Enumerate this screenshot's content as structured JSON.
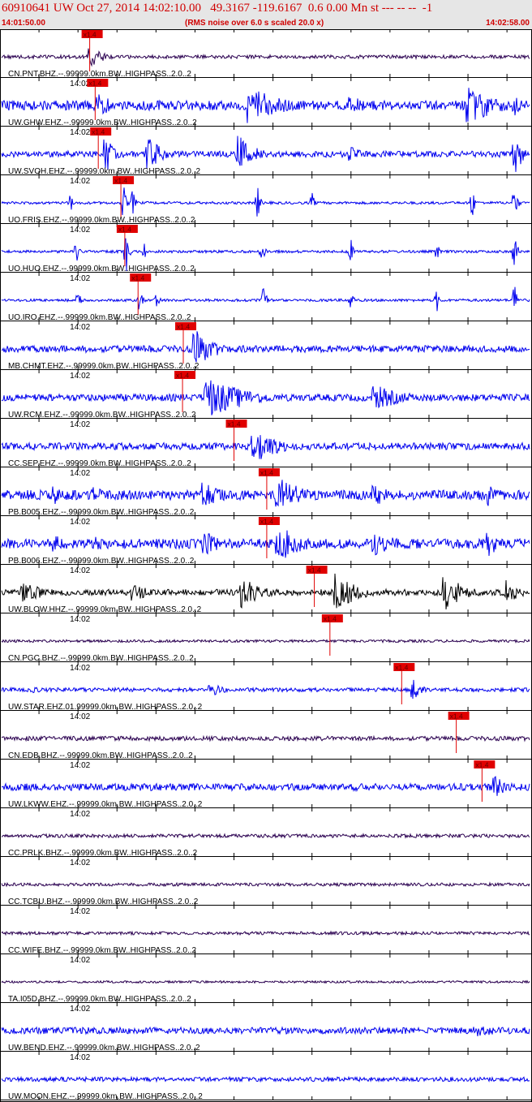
{
  "header": {
    "title": "60910641 UW Oct 27, 2014 14:02:10.00   49.3167 -119.6167  0.6 0.00 Mn st --- -- --  -1",
    "start_time": "14:01:50.00",
    "end_time": "14:02:58.00",
    "subtitle": "(RMS noise over 6.0 s scaled 20.0 x)"
  },
  "chart_data": {
    "type": "line",
    "x_range_seconds": [
      0,
      68
    ],
    "tick_interval_seconds": 5,
    "minute_mark_label": "14:02",
    "minute_mark_second": 10,
    "pick_marker_label": "x1.4",
    "traces": [
      {
        "label": "CN.PNT.BHZ.--.99999.0km.BW..HIGHPASS..2.0..2",
        "color": "#2a0050",
        "pick_second": 11.5,
        "amplitude": 0.08,
        "events": [
          [
            11.6,
            0.55,
            1.5
          ]
        ]
      },
      {
        "label": "UW.GHW.EHZ.--.99999.0km.BW..HIGHPASS..2.0..2",
        "color": "#0000ee",
        "pick_second": 12.2,
        "amplitude": 0.22,
        "events": [
          [
            12.6,
            0.6,
            2
          ],
          [
            32,
            0.9,
            4
          ],
          [
            45,
            0.45,
            3
          ],
          [
            60,
            0.9,
            4
          ],
          [
            66,
            0.5,
            2
          ]
        ]
      },
      {
        "label": "UW.SVOH.EHZ.--.99999.0km.BW..HIGHPASS..2.0..2",
        "color": "#0000ee",
        "pick_second": 12.6,
        "amplitude": 0.14,
        "events": [
          [
            13.6,
            0.9,
            1
          ],
          [
            19,
            0.95,
            1.5
          ],
          [
            30.5,
            0.95,
            2
          ],
          [
            45,
            0.4,
            1.5
          ],
          [
            66,
            1.0,
            1
          ]
        ]
      },
      {
        "label": "UO.FRIS.EHZ.--.99999.0km.BW..HIGHPASS..2.0..2",
        "color": "#0000ee",
        "pick_second": 15.5,
        "amplitude": 0.06,
        "events": [
          [
            9,
            0.55,
            0.3
          ],
          [
            15.8,
            1.0,
            0.3
          ],
          [
            17,
            0.7,
            0.3
          ],
          [
            33,
            0.9,
            0.3
          ],
          [
            40,
            0.5,
            0.3
          ],
          [
            60.5,
            0.95,
            0.3
          ],
          [
            66,
            1.0,
            0.3
          ]
        ]
      },
      {
        "label": "UO.HUO.EHZ.--.99999.0km.BW..HIGHPASS..2.0..2",
        "color": "#0000ee",
        "pick_second": 16.0,
        "amplitude": 0.06,
        "events": [
          [
            9.8,
            0.6,
            0.3
          ],
          [
            16.2,
            1.0,
            0.3
          ],
          [
            18.5,
            0.6,
            0.3
          ],
          [
            33.5,
            0.8,
            0.3
          ],
          [
            45,
            0.6,
            0.3
          ],
          [
            56,
            0.5,
            0.3
          ],
          [
            66,
            1.0,
            0.3
          ]
        ]
      },
      {
        "label": "UO.IRO.EHZ.--.99999.0km.BW..HIGHPASS..2.0..2",
        "color": "#0000ee",
        "pick_second": 17.7,
        "amplitude": 0.06,
        "events": [
          [
            10,
            0.65,
            0.3
          ],
          [
            17.8,
            1.0,
            0.3
          ],
          [
            20,
            0.6,
            0.3
          ],
          [
            33.8,
            0.8,
            0.3
          ],
          [
            45,
            0.6,
            0.3
          ],
          [
            56,
            0.6,
            0.3
          ],
          [
            66,
            1.0,
            0.3
          ]
        ]
      },
      {
        "label": "MB.CHMT.EHZ.--.99999.0km.BW..HIGHPASS..2.0..2",
        "color": "#0000ee",
        "pick_second": 23.5,
        "amplitude": 0.16,
        "events": [
          [
            25,
            0.9,
            2.5
          ]
        ]
      },
      {
        "label": "UW.RCM.EHZ.--.99999.0km.BW..HIGHPASS..2.0..2",
        "color": "#0000ee",
        "pick_second": 23.4,
        "amplitude": 0.16,
        "events": [
          [
            26.5,
            1.0,
            5
          ],
          [
            48,
            0.6,
            4
          ]
        ]
      },
      {
        "label": "CC.SEP.EHZ.--.99999.0km.BW..HIGHPASS..2.0..2",
        "color": "#0000ee",
        "pick_second": 30.0,
        "amplitude": 0.16,
        "events": [
          [
            32.5,
            0.85,
            3
          ]
        ]
      },
      {
        "label": "PB.B005.EHZ.--.99999.0km.BW..HIGHPASS..2.0..2",
        "color": "#0000ee",
        "pick_second": 34.2,
        "amplitude": 0.22,
        "events": [
          [
            7,
            0.5,
            2
          ],
          [
            12,
            0.4,
            2
          ],
          [
            26,
            0.6,
            3
          ],
          [
            35.5,
            0.95,
            3
          ],
          [
            48,
            0.5,
            3
          ],
          [
            62.5,
            0.6,
            1.5
          ]
        ]
      },
      {
        "label": "PB.B006.EHZ.--.99999.0km.BW..HIGHPASS..2.0..2",
        "color": "#0000ee",
        "pick_second": 34.2,
        "amplitude": 0.22,
        "events": [
          [
            7,
            0.5,
            2
          ],
          [
            12,
            0.4,
            2
          ],
          [
            26,
            0.6,
            3
          ],
          [
            35.5,
            0.95,
            3
          ],
          [
            48,
            0.6,
            3
          ],
          [
            62.5,
            0.75,
            1.5
          ]
        ]
      },
      {
        "label": "UW.BLOW.HHZ.--.99999.0km.BW..HIGHPASS..2.0..2",
        "color": "#000000",
        "pick_second": 40.3,
        "amplitude": 0.14,
        "events": [
          [
            3,
            0.5,
            3
          ],
          [
            17,
            0.5,
            2
          ],
          [
            31,
            0.8,
            2.5
          ],
          [
            43,
            0.9,
            3
          ],
          [
            57,
            0.9,
            2.5
          ],
          [
            65,
            0.7,
            1.5
          ]
        ]
      },
      {
        "label": "CN.PGC.BHZ.--.99999.0km.BW..HIGHPASS..2.0..2",
        "color": "#2a0050",
        "pick_second": 42.3,
        "amplitude": 0.06,
        "events": []
      },
      {
        "label": "UW.STAR.EHZ.01.99999.0km.BW..HIGHPASS..2.0..2",
        "color": "#0000ee",
        "pick_second": 51.5,
        "amplitude": 0.09,
        "events": [
          [
            4,
            0.2,
            1.5
          ],
          [
            27,
            0.3,
            2
          ],
          [
            53,
            0.5,
            1
          ]
        ]
      },
      {
        "label": "CN.EDB.BHZ.--.99999.0km.BW..HIGHPASS..2.0..2",
        "color": "#2a0050",
        "pick_second": 58.5,
        "amplitude": 0.1,
        "events": []
      },
      {
        "label": "UW.LKWW.EHZ.--.99999.0km.BW..HIGHPASS..2.0..2",
        "color": "#0000ee",
        "pick_second": 61.8,
        "amplitude": 0.16,
        "events": [
          [
            63.5,
            0.5,
            2
          ]
        ]
      },
      {
        "label": "CC.PRLK.BHZ.--.99999.0km.BW..HIGHPASS..2.0..2",
        "color": "#2a0050",
        "pick_second": null,
        "amplitude": 0.08,
        "events": []
      },
      {
        "label": "CC.TCBU.BHZ.--.99999.0km.BW..HIGHPASS..2.0..2",
        "color": "#2a0050",
        "pick_second": null,
        "amplitude": 0.07,
        "events": []
      },
      {
        "label": "CC.WIFE.BHZ.--.99999.0km.BW..HIGHPASS..2.0..2",
        "color": "#2a0050",
        "pick_second": null,
        "amplitude": 0.07,
        "events": []
      },
      {
        "label": "TA.I05D.BHZ.--.99999.0km.BW..HIGHPASS..2.0..2",
        "color": "#2a0050",
        "pick_second": null,
        "amplitude": 0.05,
        "events": []
      },
      {
        "label": "UW.BEND.EHZ.--.99999.0km.BW..HIGHPASS..2.0..2",
        "color": "#0000ee",
        "pick_second": null,
        "amplitude": 0.15,
        "events": [
          [
            61,
            0.3,
            5
          ]
        ]
      },
      {
        "label": "UW.MOON.EHZ.--.99999.0km.BW..HIGHPASS..2.0..2",
        "color": "#0000ee",
        "pick_second": null,
        "amplitude": 0.1,
        "events": []
      }
    ]
  }
}
